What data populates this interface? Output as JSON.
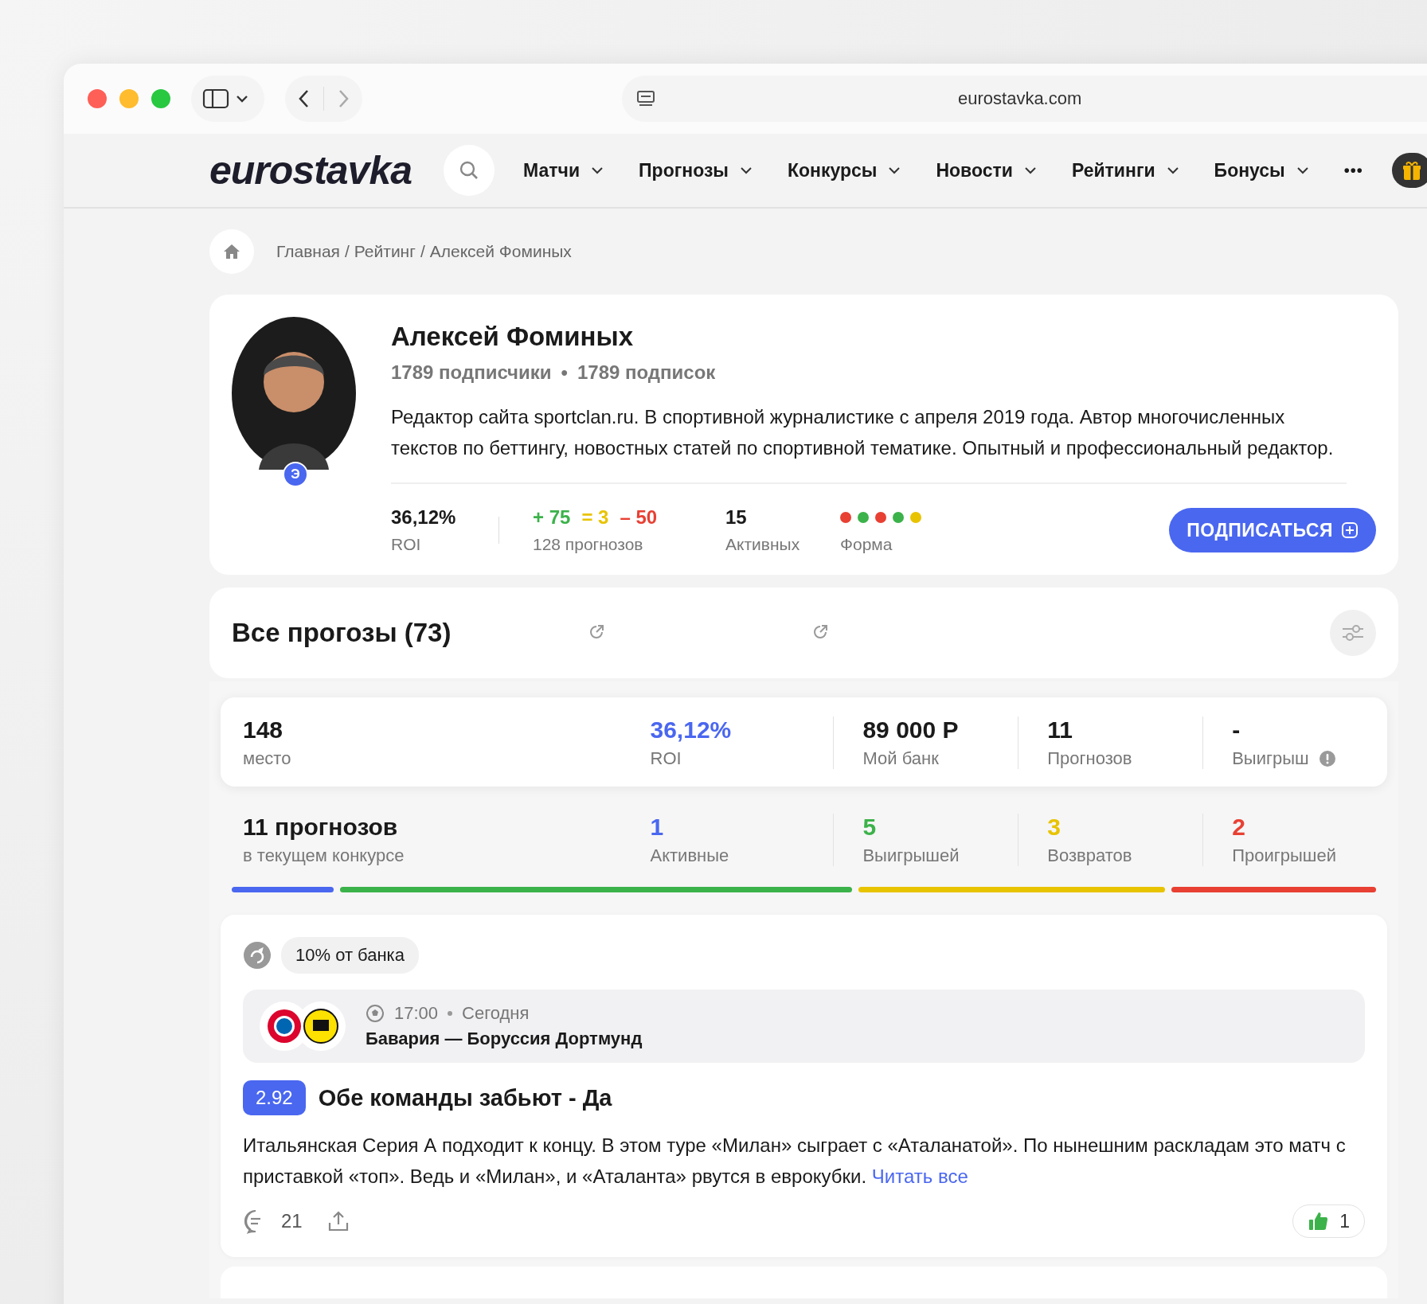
{
  "browser": {
    "url": "eurostavka.com"
  },
  "site": {
    "logo": "eurostavka",
    "nav": [
      {
        "label": "Матчи"
      },
      {
        "label": "Прогнозы"
      },
      {
        "label": "Конкурсы"
      },
      {
        "label": "Новости"
      },
      {
        "label": "Рейтинги"
      },
      {
        "label": "Бонусы"
      }
    ],
    "more": "•••"
  },
  "breadcrumb": {
    "items": [
      "Главная",
      "Рейтинг",
      "Алексей Фоминых"
    ],
    "separator": "/"
  },
  "profile": {
    "name": "Алексей Фоминых",
    "badge": "Э",
    "counts": [
      "1789 подписчики",
      "1789 подписок"
    ],
    "count_separator": "•",
    "bio": "Редактор сайта sportclan.ru. В спортивной журналистике с апреля 2019 года. Автор многочисленных текстов по беттингу, новостных статей по спортивной тематике. Опытный и профессиональный редактор.",
    "roi": {
      "value": "36,12%",
      "label": "ROI"
    },
    "record": {
      "parts": [
        {
          "text": "+ 75",
          "color": "#3cb24a"
        },
        {
          "text": "= 3",
          "color": "#e8c300"
        },
        {
          "text": "– 50",
          "color": "#e84033"
        }
      ],
      "label": "128 прогнозов"
    },
    "active": {
      "value": "15",
      "label": "Активных"
    },
    "form": {
      "label": "Форма",
      "dots": [
        {
          "color": "#e84033"
        },
        {
          "color": "#3cb24a"
        },
        {
          "color": "#e84033"
        },
        {
          "color": "#3cb24a"
        },
        {
          "color": "#e8c300"
        }
      ]
    },
    "subscribe": "ПОДПИСАТЬСЯ"
  },
  "section": {
    "title": "Все прогозы (73)"
  },
  "summary": [
    {
      "value": "148",
      "label": "место",
      "color": "#1a1a1a",
      "info": false
    },
    {
      "value": "36,12%",
      "label": "ROI",
      "color": "#4a67f0",
      "info": false
    },
    {
      "value": "89 000 Р",
      "label": "Мой банк",
      "color": "#1a1a1a",
      "info": false
    },
    {
      "value": "11",
      "label": "Прогнозов",
      "color": "#1a1a1a",
      "info": false
    },
    {
      "value": "-",
      "label": "Выигрыш",
      "color": "#1a1a1a",
      "info": true
    }
  ],
  "contest": {
    "count": "11",
    "title": "прогнозов",
    "subtitle": "в текущем конкурсе",
    "items": [
      {
        "value": "1",
        "label": "Активные",
        "color": "#4a67f0"
      },
      {
        "value": "5",
        "label": "Выигрышей",
        "color": "#3cb24a"
      },
      {
        "value": "3",
        "label": "Возвратов",
        "color": "#e8c300"
      },
      {
        "value": "2",
        "label": "Проигрышей",
        "color": "#e84033"
      }
    ]
  },
  "bet": {
    "stake": "10% от банка",
    "time": "17:00",
    "day": "Сегодня",
    "teams": "Бавария — Боруссия Дортмунд",
    "odds": "2.92",
    "pick": "Обе команды забьют - Да",
    "text": "Итальянская Серия А подходит к концу. В этом туре «Милан» сыграет с «Аталанатой». По нынешним раскладам это матч с приставкой «топ». Ведь и «Милан», и «Аталанта» рвутся в еврокубки.",
    "read_more": "Читать все",
    "comments": "21",
    "likes": "1"
  }
}
